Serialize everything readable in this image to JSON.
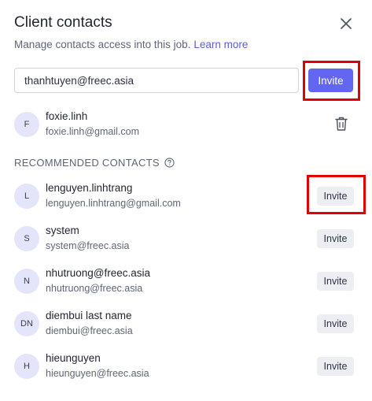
{
  "header": {
    "title": "Client contacts",
    "subtitle": "Manage contacts access into this job.",
    "learn_more": "Learn more"
  },
  "invite_form": {
    "email_value": "thanhtuyen@freec.asia",
    "invite_label": "Invite"
  },
  "current_contacts": [
    {
      "initials": "F",
      "name": "foxie.linh",
      "email": "foxie.linh@gmail.com"
    }
  ],
  "recommended": {
    "title": "RECOMMENDED CONTACTS",
    "invite_label": "Invite",
    "items": [
      {
        "initials": "L",
        "name": "lenguyen.linhtrang",
        "email": "lenguyen.linhtrang@gmail.com"
      },
      {
        "initials": "S",
        "name": "system",
        "email": "system@freec.asia"
      },
      {
        "initials": "N",
        "name": "nhutruong@freec.asia",
        "email": "nhutruong@freec.asia"
      },
      {
        "initials": "DN",
        "name": "diembui last name",
        "email": "diembui@freec.asia"
      },
      {
        "initials": "H",
        "name": "hieunguyen",
        "email": "hieunguyen@freec.asia"
      }
    ]
  },
  "colors": {
    "primary": "#6366f1",
    "link": "#5b5fd6",
    "highlight": "#e30000",
    "avatar_bg": "#e4e4fb"
  },
  "icons": [
    "close-icon",
    "trash-icon",
    "help-circle-icon"
  ]
}
